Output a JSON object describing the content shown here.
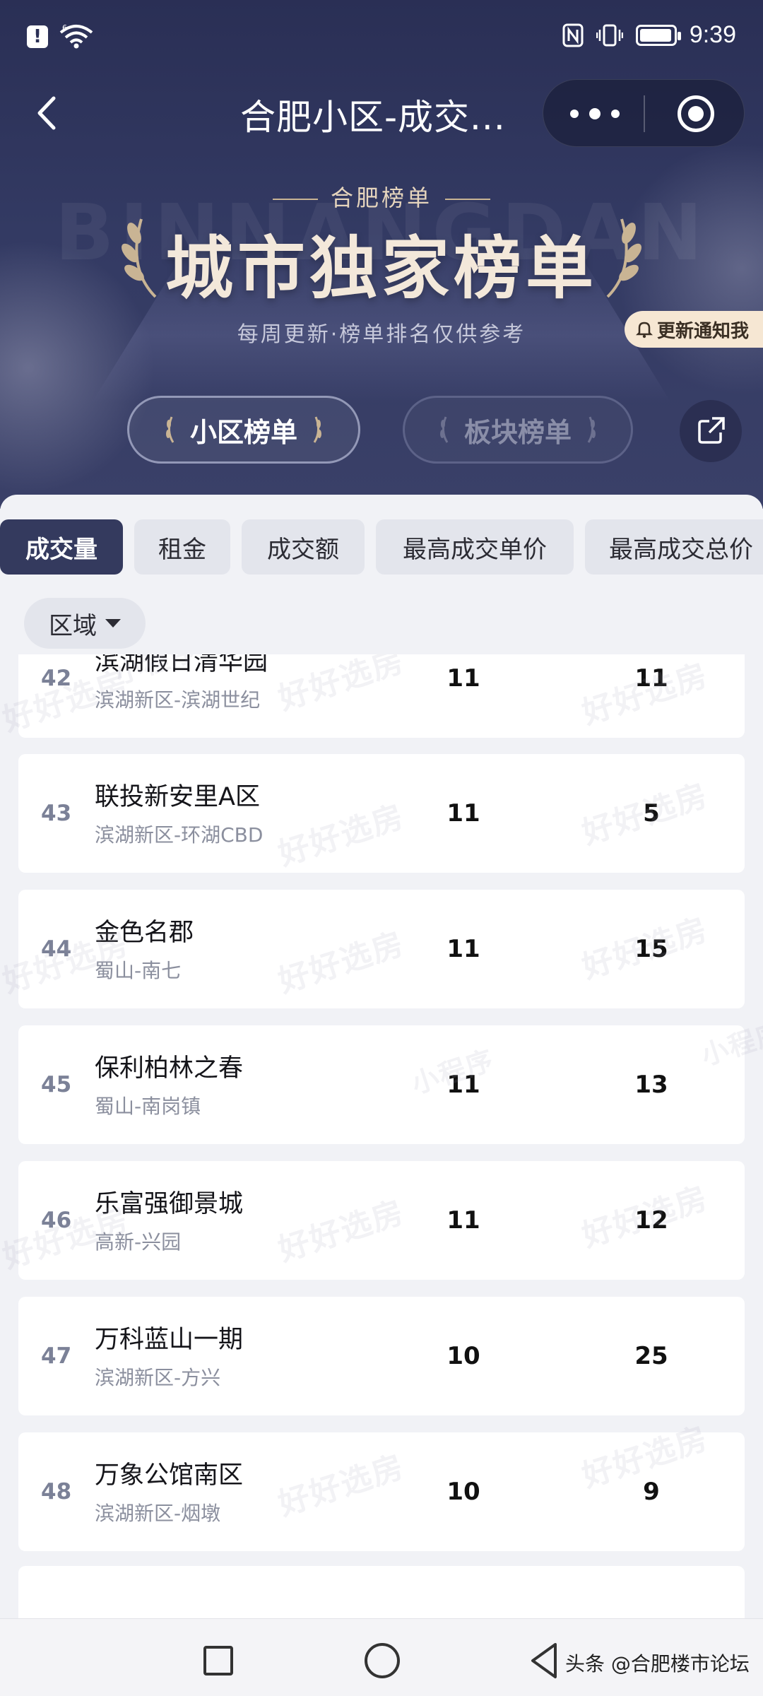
{
  "status_bar": {
    "signal_label": "6",
    "time": "9:39",
    "icons": [
      "alert-icon",
      "wifi-icon",
      "nfc-icon",
      "vibrate-icon",
      "battery-icon"
    ],
    "battery_level": 0.95
  },
  "nav": {
    "title": "合肥小区-成交...",
    "icons": [
      "back-icon",
      "more-icon",
      "target-icon"
    ]
  },
  "banner": {
    "subtitle": "合肥榜单",
    "background_text": "BINNANGDAN",
    "title": "城市独家榜单",
    "description": "每周更新·榜单排名仅供参考",
    "notify_label": "更新通知我"
  },
  "rank_tabs": [
    {
      "label": "小区榜单",
      "active": true
    },
    {
      "label": "板块榜单",
      "active": false
    }
  ],
  "metric_tabs": [
    {
      "label": "成交量",
      "active": true
    },
    {
      "label": "租金",
      "active": false
    },
    {
      "label": "成交额",
      "active": false
    },
    {
      "label": "最高成交单价",
      "active": false
    },
    {
      "label": "最高成交总价",
      "active": false
    }
  ],
  "filter": {
    "area_label": "区域"
  },
  "rows": [
    {
      "rank": "42",
      "name": "滨湖假日清华园",
      "location": "滨湖新区-滨湖世纪",
      "value1": "11",
      "value2": "11"
    },
    {
      "rank": "43",
      "name": "联投新安里A区",
      "location": "滨湖新区-环湖CBD",
      "value1": "11",
      "value2": "5"
    },
    {
      "rank": "44",
      "name": "金色名郡",
      "location": "蜀山-南七",
      "value1": "11",
      "value2": "15"
    },
    {
      "rank": "45",
      "name": "保利柏林之春",
      "location": "蜀山-南岗镇",
      "value1": "11",
      "value2": "13"
    },
    {
      "rank": "46",
      "name": "乐富强御景城",
      "location": "高新-兴园",
      "value1": "11",
      "value2": "12"
    },
    {
      "rank": "47",
      "name": "万科蓝山一期",
      "location": "滨湖新区-方兴",
      "value1": "10",
      "value2": "25"
    },
    {
      "rank": "48",
      "name": "万象公馆南区",
      "location": "滨湖新区-烟墩",
      "value1": "10",
      "value2": "9"
    }
  ],
  "watermark": {
    "text": "好好选房",
    "text2": "小程序"
  },
  "bottom_nav": {
    "icons": [
      "recent-apps-icon",
      "home-icon",
      "back-triangle-icon"
    ],
    "source_label": "头条 @合肥楼市论坛"
  },
  "colors": {
    "header_bg": "#2a2f55",
    "active_tab": "#343a5e",
    "banner_title": "#f3e8da",
    "notify_bg": "#f6e7d3"
  }
}
